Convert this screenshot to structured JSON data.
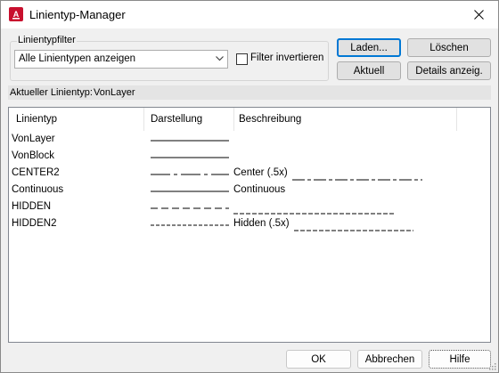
{
  "window": {
    "title": "Linientyp-Manager",
    "close_glyph": "✕"
  },
  "filter": {
    "group_label": "Linientypfilter",
    "selected_option": "Alle Linientypen anzeigen",
    "invert_checkbox_label": "Filter invertieren",
    "invert_checked": false
  },
  "buttons": {
    "load": "Laden...",
    "delete": "Löschen",
    "current": "Aktuell",
    "details": "Details anzeig.",
    "ok": "OK",
    "cancel": "Abbrechen",
    "help": "Hilfe"
  },
  "current_linetype": {
    "label": "Aktueller Linientyp:",
    "value": "VonLayer"
  },
  "list": {
    "columns": [
      "Linientyp",
      "Darstellung",
      "Beschreibung"
    ],
    "rows": [
      {
        "name": "VonLayer",
        "pattern": "solid",
        "description": ""
      },
      {
        "name": "VonBlock",
        "pattern": "solid",
        "description": ""
      },
      {
        "name": "CENTER2",
        "pattern": "center",
        "description": "Center (.5x)"
      },
      {
        "name": "Continuous",
        "pattern": "solid",
        "description": "Continuous"
      },
      {
        "name": "HIDDEN",
        "pattern": "hidden",
        "description": ""
      },
      {
        "name": "HIDDEN2",
        "pattern": "hidden-fine",
        "description": "Hidden (.5x)"
      }
    ]
  },
  "colors": {
    "accent": "#0078d4",
    "app_icon": "#c8102e"
  },
  "icons": {
    "app": "autocad-icon",
    "close": "close-icon",
    "dropdown": "chevron-down-icon",
    "resize": "resize-grip-icon"
  }
}
